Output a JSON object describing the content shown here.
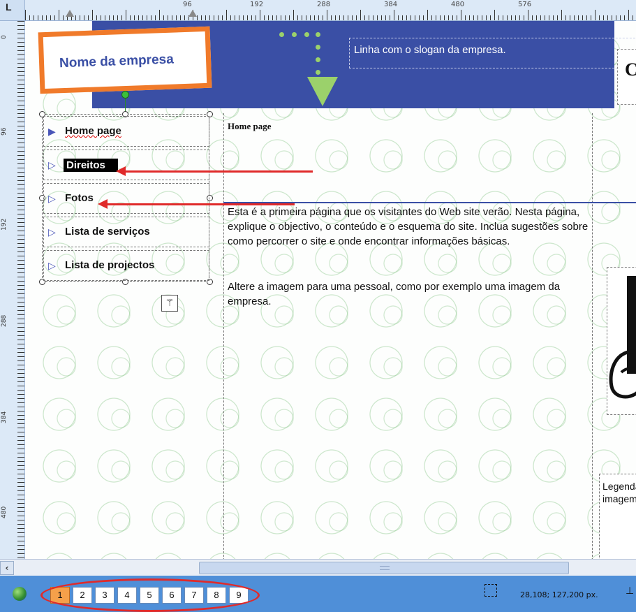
{
  "ruler": {
    "top_labels": [
      "96",
      "192",
      "288",
      "384",
      "480",
      "576"
    ],
    "left_labels": [
      "0",
      "96",
      "192",
      "288",
      "384",
      "480"
    ],
    "corner": "L"
  },
  "header": {
    "company_name": "Nome da empresa",
    "slogan": "Linha com o slogan da empresa.",
    "right_letter": "C"
  },
  "nav": {
    "items": [
      {
        "label": "Home page",
        "bullet": "▶"
      },
      {
        "label": "Direitos",
        "bullet": "▷"
      },
      {
        "label": "Fotos",
        "bullet": "▷"
      },
      {
        "label": "Lista de serviços",
        "bullet": "▷"
      },
      {
        "label": "Lista de projectos",
        "bullet": "▷"
      }
    ]
  },
  "content": {
    "page_title": "Home page",
    "paragraph1": "Esta é a primeira página que os visitantes do Web site verão. Nesta página, explique o objectivo, o conteúdo e o esquema do site. Inclua sugestões sobre como percorrer o site e onde encontrar informações básicas.",
    "paragraph2": "Altere a imagem para uma pessoal, como por exemplo uma imagem da empresa.",
    "caption": "Legenda da imagem"
  },
  "statusbar": {
    "pages": [
      "1",
      "2",
      "3",
      "4",
      "5",
      "6",
      "7",
      "8",
      "9"
    ],
    "active_page": "1",
    "coordinates": "28,108; 127,200 px."
  },
  "colors": {
    "header_blue": "#3a4fa5",
    "logo_orange": "#f07a2a",
    "accent_green": "#9bd16b",
    "annotation_red": "#e02a2a",
    "statusbar_blue": "#4f8fd8"
  }
}
